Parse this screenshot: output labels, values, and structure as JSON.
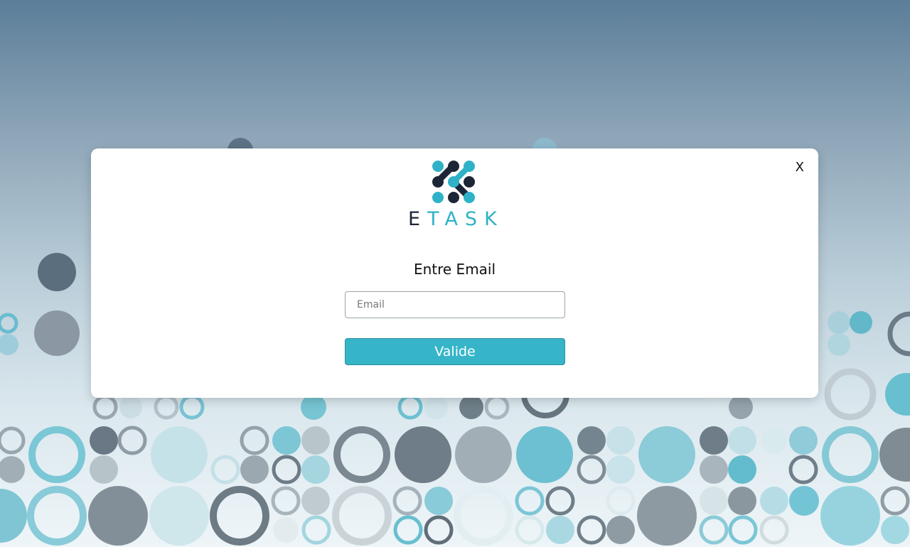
{
  "modal": {
    "close_label": "X",
    "brand": {
      "logo_text_first": "E",
      "logo_text_rest": "TASK"
    },
    "title": "Entre Email",
    "email_field": {
      "value": "",
      "placeholder": "Email"
    },
    "submit_label": "Valide"
  },
  "colors": {
    "accent": "#36b5c8",
    "brand_dark": "#1c2636",
    "brand_teal": "#2fb2c7"
  },
  "icons": {
    "logo": "etask-dots-logo-icon",
    "close": "close-icon"
  }
}
